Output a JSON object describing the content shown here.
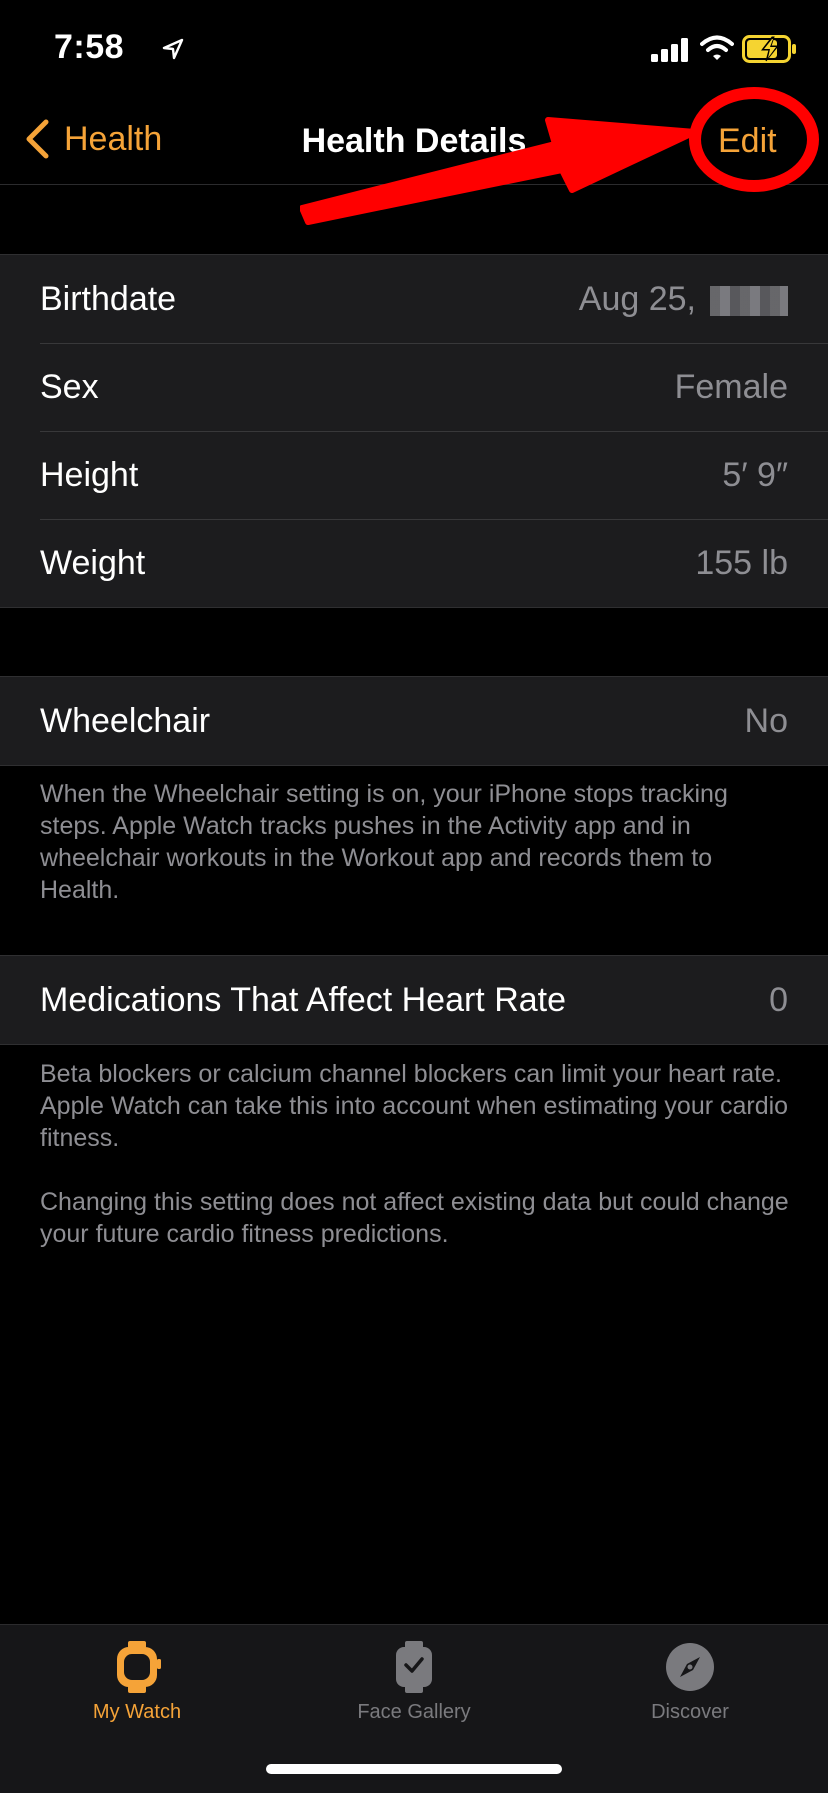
{
  "status_bar": {
    "time": "7:58"
  },
  "nav": {
    "back_label": "Health",
    "title": "Health Details",
    "edit_label": "Edit"
  },
  "accent_color": "#f5a338",
  "annotation_color": "#ff0000",
  "details": [
    {
      "label": "Birthdate",
      "value": "Aug 25,"
    },
    {
      "label": "Sex",
      "value": "Female"
    },
    {
      "label": "Height",
      "value": "5′ 9″"
    },
    {
      "label": "Weight",
      "value": "155 lb"
    }
  ],
  "wheelchair": {
    "label": "Wheelchair",
    "value": "No",
    "footnote": "When the Wheelchair setting is on, your iPhone stops tracking steps. Apple Watch tracks pushes in the Activity app and in wheelchair workouts in the Workout app and records them to Health."
  },
  "medications": {
    "label": "Medications That Affect Heart Rate",
    "value": "0",
    "footnote_1": "Beta blockers or calcium channel blockers can limit your heart rate. Apple Watch can take this into account when estimating your cardio fitness.",
    "footnote_2": "Changing this setting does not affect existing data but could change your future cardio fitness predictions."
  },
  "tabs": [
    {
      "label": "My Watch",
      "icon": "watch-icon",
      "active": true
    },
    {
      "label": "Face Gallery",
      "icon": "face-gallery-icon",
      "active": false
    },
    {
      "label": "Discover",
      "icon": "compass-icon",
      "active": false
    }
  ]
}
